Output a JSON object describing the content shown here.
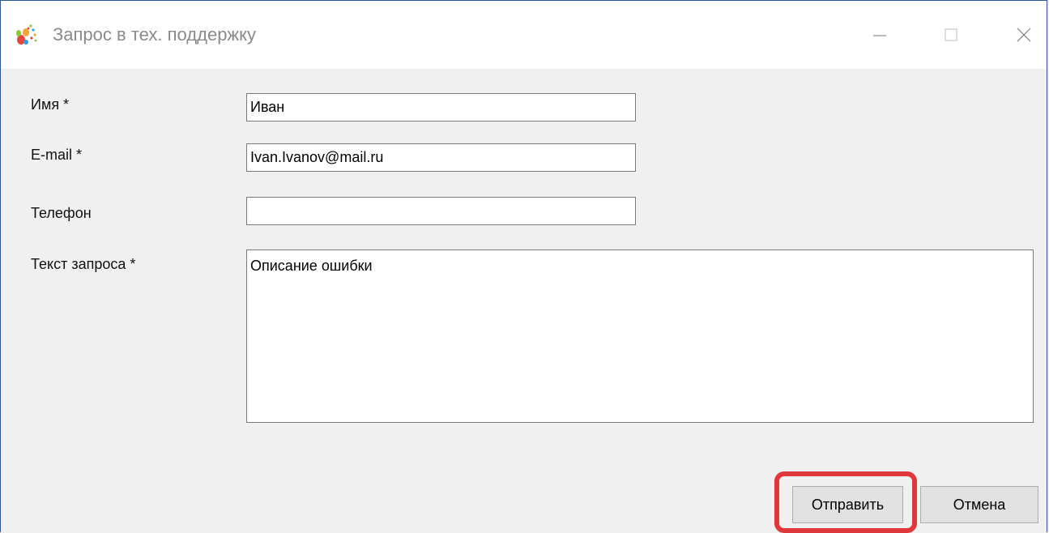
{
  "window": {
    "title": "Запрос в тех. поддержку",
    "controls": {
      "minimize": "minimize",
      "maximize": "maximize",
      "close": "close"
    }
  },
  "form": {
    "name_label": "Имя *",
    "name_value": "Иван",
    "email_label": "E-mail *",
    "email_value": "Ivan.Ivanov@mail.ru",
    "phone_label": "Телефон",
    "phone_value": "",
    "text_label": "Текст запроса *",
    "text_value": "Описание ошибки"
  },
  "buttons": {
    "send": "Отправить",
    "cancel": "Отмена"
  },
  "colors": {
    "highlight": "#e0373a",
    "window_border": "#2b579a"
  }
}
